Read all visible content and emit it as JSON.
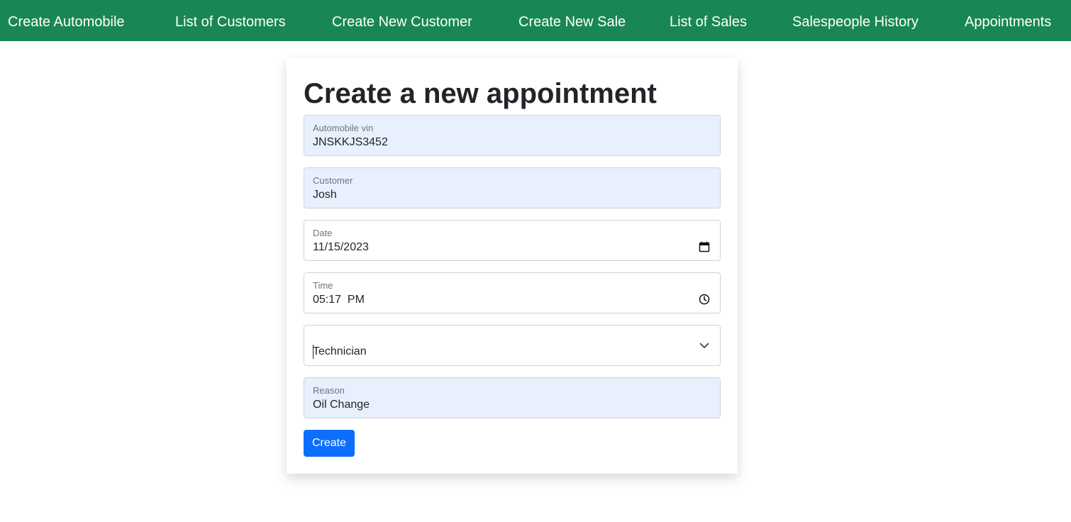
{
  "nav": {
    "items": [
      {
        "label": "Create Automobile"
      },
      {
        "label": "List of Customers"
      },
      {
        "label": "Create New Customer"
      },
      {
        "label": "Create New Sale"
      },
      {
        "label": "List of Sales"
      },
      {
        "label": "Salespeople History"
      },
      {
        "label": "Appointments"
      }
    ]
  },
  "form": {
    "title": "Create a new appointment",
    "vin": {
      "label": "Automobile vin",
      "value": "JNSKKJS3452"
    },
    "customer": {
      "label": "Customer",
      "value": "Josh"
    },
    "date": {
      "label": "Date",
      "value": "11/15/2023",
      "icon": "calendar-icon"
    },
    "time": {
      "label": "Time",
      "value": "05:17  PM",
      "icon": "clock-icon"
    },
    "technician": {
      "value": "Technician",
      "icon": "chevron-down-icon"
    },
    "reason": {
      "label": "Reason",
      "value": "Oil Change"
    },
    "submit_label": "Create"
  },
  "colors": {
    "navbar": "#198754",
    "autofill": "#e8f0fe",
    "primary_button": "#0d6efd"
  }
}
